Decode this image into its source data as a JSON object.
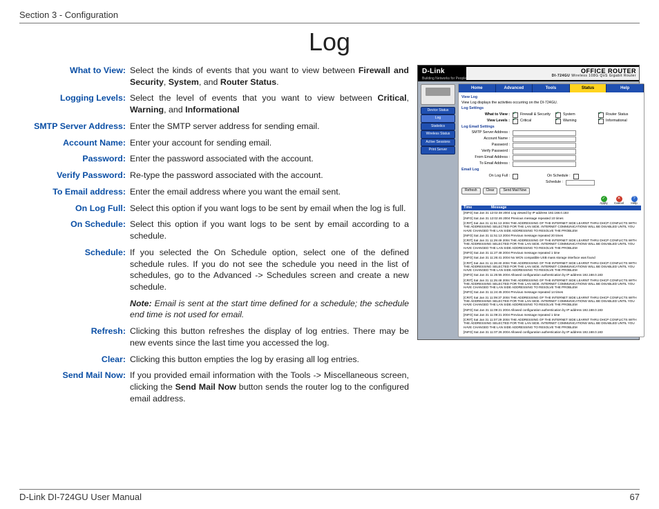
{
  "header": {
    "section": "Section 3 - Configuration"
  },
  "title": "Log",
  "defs": {
    "what_to_view": {
      "label": "What to View:",
      "pre": "Select the kinds of events that you want to view between ",
      "b1": "Firewall and Security",
      "sep1": ", ",
      "b2": "System",
      "sep2": ", and ",
      "b3": "Router Status",
      "post": "."
    },
    "logging_levels": {
      "label": "Logging Levels:",
      "pre": "Select the level of events that you want to view between ",
      "b1": "Critical",
      "sep1": ", ",
      "b2": "Warning",
      "sep2": ", and ",
      "b3": "Informational",
      "post": ""
    },
    "smtp": {
      "label": "SMTP Server Address:",
      "text": "Enter the SMTP server address for sending email."
    },
    "account": {
      "label": "Account Name:",
      "text": "Enter your account for sending email."
    },
    "password": {
      "label": "Password:",
      "text": "Enter the password associated with the account."
    },
    "verify": {
      "label": "Verify Password:",
      "text": "Re-type the password associated with the account."
    },
    "toemail": {
      "label": "To Email address:",
      "text": "Enter the email address where you want the email sent."
    },
    "onlogfull": {
      "label": "On Log Full:",
      "text": "Select this option if you want logs to be sent by email when the log is full."
    },
    "onschedule": {
      "label": "On Schedule:",
      "text": "Select this option if you want logs to be sent by email according to a schedule."
    },
    "schedule": {
      "label": "Schedule:",
      "text": "If you selected the On Schedule option, select one of the defined schedule rules. If you do not see the schedule you need in the list of schedules, go to the Advanced -> Schedules screen and create a new schedule."
    },
    "note": {
      "b": "Note:",
      "text": " Email is sent at the start time defined for a schedule; the schedule end time is not used for email."
    },
    "refresh": {
      "label": "Refresh:",
      "text": "Clicking this button refreshes the display of log entries. There may be new events since the last time you accessed the log."
    },
    "clear": {
      "label": "Clear:",
      "text": "Clicking this button empties the log by erasing all log entries."
    },
    "sendmail": {
      "label": "Send Mail Now:",
      "pre": "If you provided email information with the Tools -> Miscellaneous screen, clicking the ",
      "b1": "Send Mail Now",
      "post": " button sends the router log to the configured email address."
    }
  },
  "footer": {
    "manual": "D-Link DI-724GU User Manual",
    "page": "67"
  },
  "sshot": {
    "brand": "D-Link",
    "brand_sub": "Building Networks for People",
    "office": "OFFICE ROUTER",
    "model": "DI-724GU",
    "model_desc": "Wireless 108G QoS Gigabit Router",
    "tabs": [
      "Home",
      "Advanced",
      "Tools",
      "Status",
      "Help"
    ],
    "active_tab": 3,
    "side": [
      "Device Status",
      "Log",
      "Statistics",
      "Wireless Status",
      "Active Sessions",
      "Print Server"
    ],
    "side_sel": 1,
    "view_log_h": "View Log",
    "view_log_desc": "View Log displays the activities occurring on the DI-724GU.",
    "log_settings_h": "Log Settings",
    "wtv_label": "What to View :",
    "wtv_opts": [
      "Firewall & Security",
      "System",
      "Router Status"
    ],
    "vl_label": "View Levels :",
    "vl_opts": [
      "Critical",
      "Warning",
      "Informational"
    ],
    "les_h": "Log Email Settings",
    "les_labels": [
      "SMTP Server Address :",
      "Account Name :",
      "Password :",
      "Verify Password :",
      "From Email Address :",
      "To Email Address :"
    ],
    "email_log_h": "Email Log",
    "onlogfull": "On Log Full :",
    "onschedule": "On Schedule :",
    "schedule": "Schedule :",
    "btns": [
      "Refresh",
      "Clear",
      "Send Mail Now"
    ],
    "icons": [
      "Apply",
      "Cancel",
      "Help"
    ],
    "log_cols": [
      "Time",
      "Message"
    ],
    "log_lines": [
      "[INFO] Sat Jan 31 12:02:48 2004 Log viewed by IP address 192.168.0.183",
      "[INFO] Sat Jan 31 12:02:46 2004 Previous message repeated 10 times",
      "[CRIT] Sat Jan 31 11:51:13 2004 THE ADDRESSING OF THE INTERNET SIDE LEARNT THRU DHCP CONFLICTS WITH THE ADDRESSING SELECTED FOR THE LAN SIDE. INTERNET COMMUNICATIONS WILL BE DISABLED UNTIL YOU HAVE CHANGED THE LAN SIDE ADDRESSING TO RESOLVE THE PROBLEM",
      "[INFO] Sat Jan 31 11:51:13 2004 Previous message repeated 20 times",
      "[CRIT] Sat Jan 31 11:29:49 2004 THE ADDRESSING OF THE INTERNET SIDE LEARNT THRU DHCP CONFLICTS WITH THE ADDRESSING SELECTED FOR THE LAN SIDE. INTERNET COMMUNICATIONS WILL BE DISABLED UNTIL YOU HAVE CHANGED THE LAN SIDE ADDRESSING TO RESOLVE THE PROBLEM",
      "[INFO] Sat Jan 31 11:27:48 2004 Previous message repeated 1 time",
      "[INFO] Sat Jan 31 11:26:41 2004 No WCN compatible USB mass storage interface was found",
      "[CRIT] Sat Jan 31 11:26:40 2004 THE ADDRESSING OF THE INTERNET SIDE LEARNT THRU DHCP CONFLICTS WITH THE ADDRESSING SELECTED FOR THE LAN SIDE. INTERNET COMMUNICATIONS WILL BE DISABLED UNTIL YOU HAVE CHANGED THE LAN SIDE ADDRESSING TO RESOLVE THE PROBLEM",
      "[INFO] Sat Jan 31 11:25:55 2004 Allowed configuration authentication by IP address 192.168.0.183",
      "[CRIT] Sat Jan 31 11:25:48 2004 THE ADDRESSING OF THE INTERNET SIDE LEARNT THRU DHCP CONFLICTS WITH THE ADDRESSING SELECTED FOR THE LAN SIDE. INTERNET COMMUNICATIONS WILL BE DISABLED UNTIL YOU HAVE CHANGED THE LAN SIDE ADDRESSING TO RESOLVE THE PROBLEM",
      "[INFO] Sat Jan 31 11:24:45 2004 Previous message repeated 14 times",
      "[CRIT] Sat Jan 31 11:09:37 2004 THE ADDRESSING OF THE INTERNET SIDE LEARNT THRU DHCP CONFLICTS WITH THE ADDRESSING SELECTED FOR THE LAN SIDE. INTERNET COMMUNICATIONS WILL BE DISABLED UNTIL YOU HAVE CHANGED THE LAN SIDE ADDRESSING TO RESOLVE THE PROBLEM",
      "[INFO] Sat Jan 31 11:09:21 2004 Allowed configuration authentication by IP address 192.168.0.183",
      "[INFO] Sat Jan 31 11:09:21 2004 Previous message repeated 1 time",
      "[CRIT] Sat Jan 31 11:07:29 2004 THE ADDRESSING OF THE INTERNET SIDE LEARNT THRU DHCP CONFLICTS WITH THE ADDRESSING SELECTED FOR THE LAN SIDE. INTERNET COMMUNICATIONS WILL BE DISABLED UNTIL YOU HAVE CHANGED THE LAN SIDE ADDRESSING TO RESOLVE THE PROBLEM",
      "[INFO] Sat Jan 31 11:07:26 2004 Allowed configuration authentication by IP address 192.168.0.183"
    ]
  }
}
